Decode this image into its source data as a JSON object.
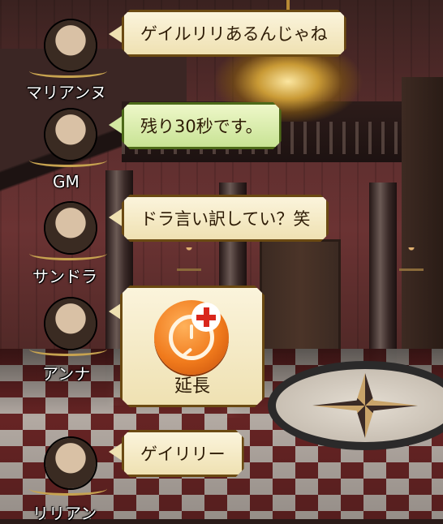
{
  "colors": {
    "bubble_cream": "#f6ecc8",
    "bubble_green": "#d3e8a2",
    "bubble_border": "#6b4a12",
    "name_text": "#ffffff",
    "extend_orange": "#f07a1c",
    "extend_plus_red": "#d9261c"
  },
  "chat": [
    {
      "name": "マリアンヌ",
      "message": "ゲイルリリあるんじゃね",
      "style": "cream",
      "avatar_icon": "woman-dark-hair-avatar"
    },
    {
      "name": "GM",
      "message": "残り30秒です。",
      "style": "green",
      "avatar_icon": "old-man-avatar"
    },
    {
      "name": "サンドラ",
      "message": "ドラ言い訳してい？笑",
      "style": "cream",
      "avatar_icon": "blonde-girl-avatar"
    },
    {
      "name": "アンナ",
      "stamp": {
        "label": "延長",
        "icon": "clock-plus-icon"
      },
      "style": "cream",
      "avatar_icon": "brown-hair-woman-avatar"
    },
    {
      "name": "リリアン",
      "message": "ゲイリリー",
      "style": "cream",
      "avatar_icon": "purple-hair-woman-avatar"
    }
  ]
}
